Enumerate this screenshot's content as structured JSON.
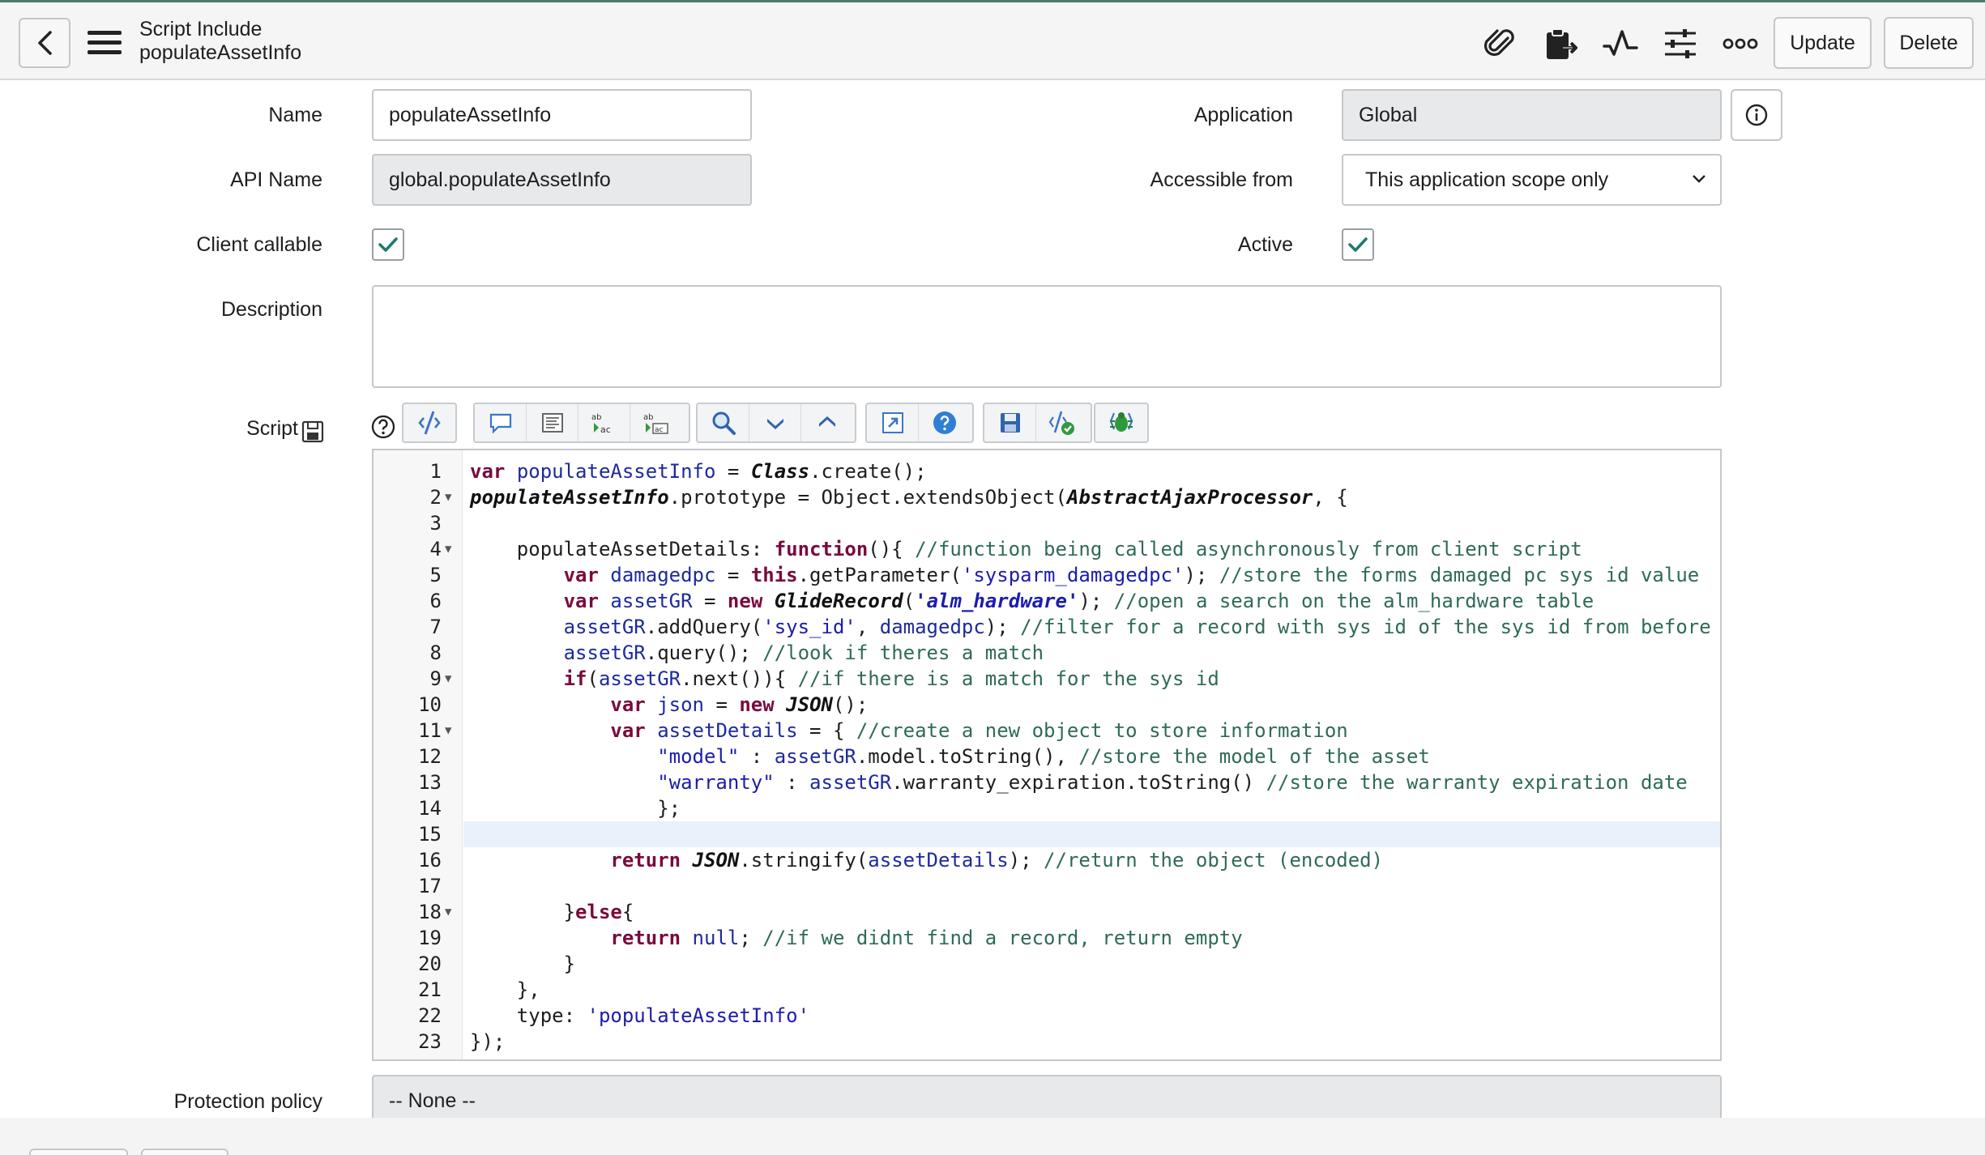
{
  "header": {
    "record_type": "Script Include",
    "record_name": "populateAssetInfo",
    "update_label": "Update",
    "delete_label": "Delete"
  },
  "form": {
    "name_label": "Name",
    "name_value": "populateAssetInfo",
    "api_name_label": "API Name",
    "api_name_value": "global.populateAssetInfo",
    "client_callable_label": "Client callable",
    "client_callable_checked": true,
    "description_label": "Description",
    "description_value": "",
    "application_label": "Application",
    "application_value": "Global",
    "accessible_from_label": "Accessible from",
    "accessible_from_value": "This application scope only",
    "active_label": "Active",
    "active_checked": true,
    "script_label": "Script",
    "protection_policy_label": "Protection policy",
    "protection_policy_value": "-- None --"
  },
  "editor": {
    "active_line": 15,
    "lines": [
      "1",
      "2",
      "3",
      "4",
      "5",
      "6",
      "7",
      "8",
      "9",
      "10",
      "11",
      "12",
      "13",
      "14",
      "15",
      "16",
      "17",
      "18",
      "19",
      "20",
      "21",
      "22",
      "23"
    ]
  },
  "colors": {
    "accent_top": "#4d7a6e",
    "keyword": "#7a0a3d",
    "string": "#1b1cae",
    "comment": "#2f6b55",
    "variable": "#1d2a9c",
    "check": "#1f7a6a"
  }
}
